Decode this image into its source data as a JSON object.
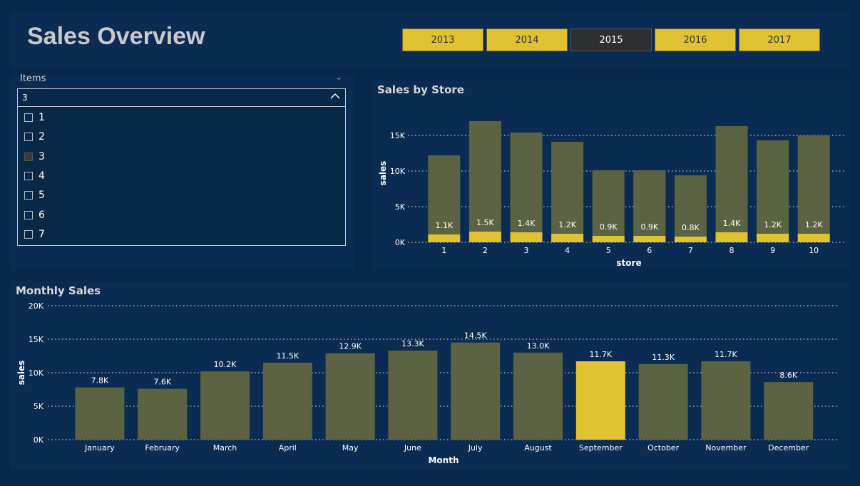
{
  "header": {
    "title": "Sales Overview",
    "years": [
      {
        "label": "2013",
        "selected": false
      },
      {
        "label": "2014",
        "selected": false
      },
      {
        "label": "2015",
        "selected": true
      },
      {
        "label": "2016",
        "selected": false
      },
      {
        "label": "2017",
        "selected": false
      }
    ]
  },
  "slicer": {
    "label": "Items",
    "value": "3",
    "options": [
      {
        "label": "1",
        "checked": false
      },
      {
        "label": "2",
        "checked": false
      },
      {
        "label": "3",
        "checked": true
      },
      {
        "label": "4",
        "checked": false
      },
      {
        "label": "5",
        "checked": false
      },
      {
        "label": "6",
        "checked": false
      },
      {
        "label": "7",
        "checked": false
      }
    ]
  },
  "colors": {
    "total": "#5c6342",
    "highlight": "#e0c233",
    "grid": "#c4cad2",
    "text": "#ffffff"
  },
  "chart_data": [
    {
      "type": "bar",
      "title": "Sales by Store",
      "xlabel": "store",
      "ylabel": "sales",
      "categories": [
        "1",
        "2",
        "3",
        "4",
        "5",
        "6",
        "7",
        "8",
        "9",
        "10"
      ],
      "series": [
        {
          "values": [
            12200,
            17000,
            15400,
            14100,
            10100,
            10100,
            9400,
            16300,
            14300,
            15000
          ]
        },
        {
          "values": [
            1100,
            1500,
            1400,
            1200,
            900,
            900,
            800,
            1400,
            1200,
            1200
          ]
        }
      ],
      "data_labels": [
        "1.1K",
        "1.5K",
        "1.4K",
        "1.2K",
        "0.9K",
        "0.9K",
        "0.8K",
        "1.4K",
        "1.2K",
        "1.2K"
      ],
      "yticks": [
        "0K",
        "5K",
        "10K",
        "15K"
      ],
      "ylim": [
        0,
        17500
      ],
      "grid": true
    },
    {
      "type": "bar",
      "title": "Monthly Sales",
      "xlabel": "Month",
      "ylabel": "sales",
      "categories": [
        "January",
        "February",
        "March",
        "April",
        "May",
        "June",
        "July",
        "August",
        "September",
        "October",
        "November",
        "December"
      ],
      "values": [
        7800,
        7600,
        10200,
        11500,
        12900,
        13300,
        14500,
        13000,
        11700,
        11300,
        11700,
        8600
      ],
      "data_labels": [
        "7.8K",
        "7.6K",
        "10.2K",
        "11.5K",
        "12.9K",
        "13.3K",
        "14.5K",
        "13.0K",
        "11.7K",
        "11.3K",
        "11.7K",
        "8.6K"
      ],
      "highlighted": "September",
      "yticks": [
        "0K",
        "5K",
        "10K",
        "15K",
        "20K"
      ],
      "ylim": [
        0,
        20000
      ],
      "grid": true
    }
  ]
}
